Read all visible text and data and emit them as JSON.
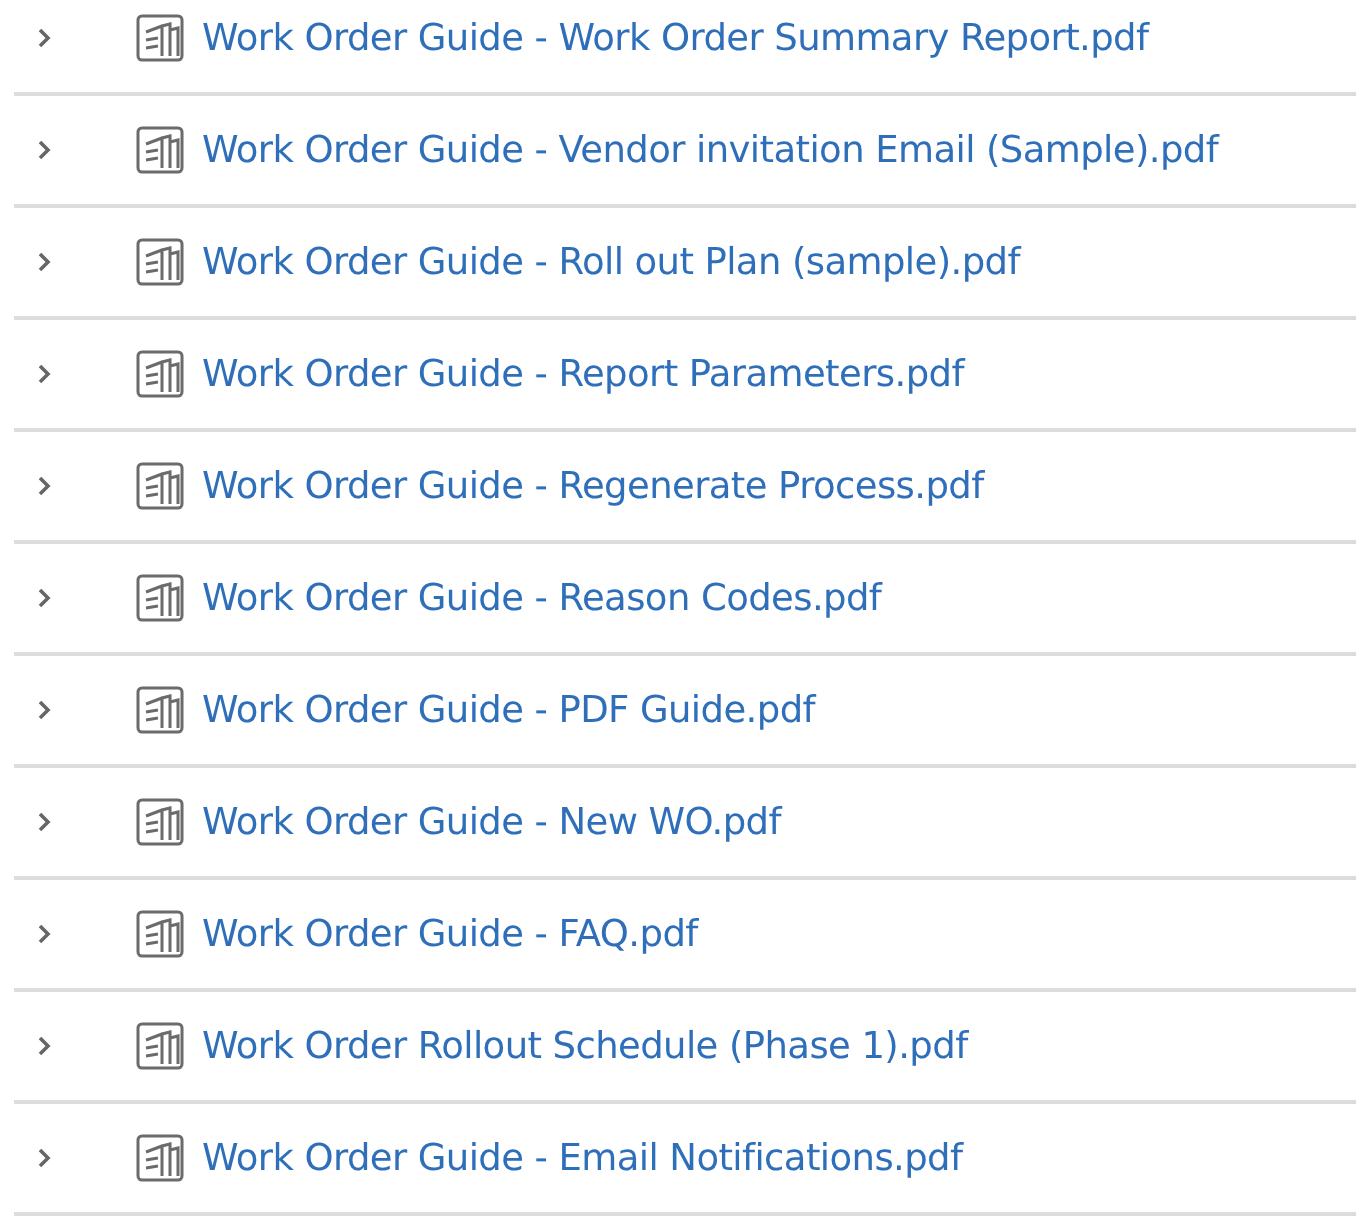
{
  "files": [
    {
      "label": "Work Order Guide - Work Order Summary Report.pdf",
      "expanded": false
    },
    {
      "label": "Work Order Guide - Vendor invitation Email (Sample).pdf",
      "expanded": false
    },
    {
      "label": "Work Order Guide - Roll out Plan (sample).pdf",
      "expanded": false
    },
    {
      "label": "Work Order Guide - Report Parameters.pdf",
      "expanded": false
    },
    {
      "label": "Work Order Guide - Regenerate Process.pdf",
      "expanded": false
    },
    {
      "label": "Work Order Guide - Reason Codes.pdf",
      "expanded": false
    },
    {
      "label": "Work Order Guide - PDF Guide.pdf",
      "expanded": false
    },
    {
      "label": "Work Order Guide - New WO.pdf",
      "expanded": false
    },
    {
      "label": "Work Order Guide - FAQ.pdf",
      "expanded": false
    },
    {
      "label": "Work Order Rollout Schedule (Phase 1).pdf",
      "expanded": false
    },
    {
      "label": "Work Order Guide - Email Notifications.pdf",
      "expanded": false
    }
  ]
}
